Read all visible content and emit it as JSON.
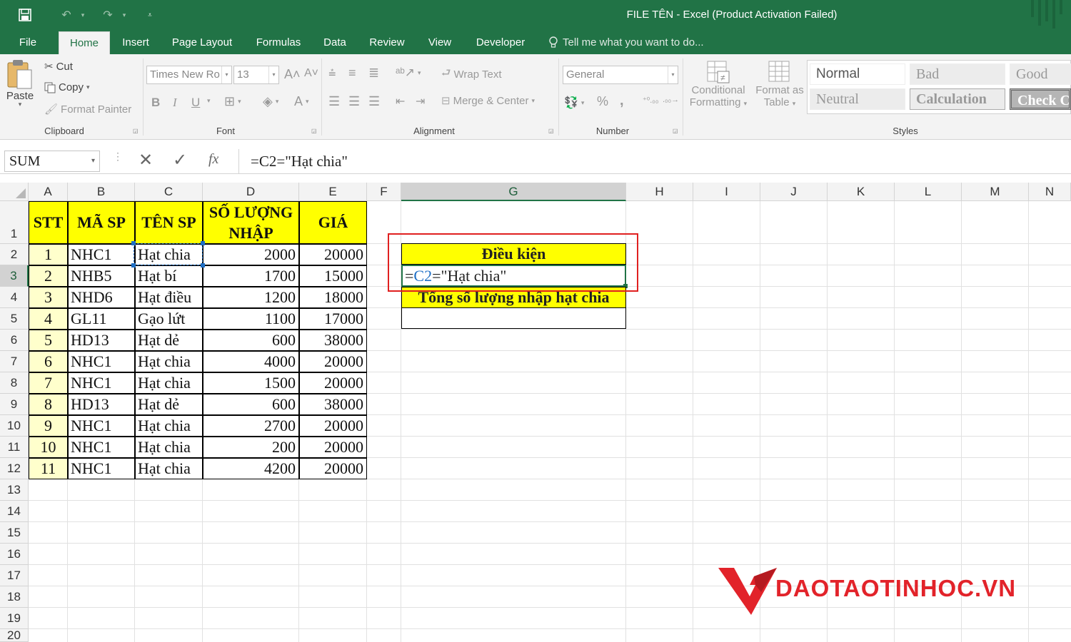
{
  "window": {
    "title": "FILE TÊN - Excel (Product Activation Failed)"
  },
  "tabs": [
    "File",
    "Home",
    "Insert",
    "Page Layout",
    "Formulas",
    "Data",
    "Review",
    "View",
    "Developer"
  ],
  "tell_me": "Tell me what you want to do...",
  "clipboard": {
    "paste": "Paste",
    "cut": "Cut",
    "copy": "Copy",
    "format_painter": "Format Painter",
    "label": "Clipboard"
  },
  "font": {
    "name": "Times New Ro",
    "size": "13",
    "bold": "B",
    "italic": "I",
    "underline": "U",
    "label": "Font"
  },
  "alignment": {
    "wrap_text": "Wrap Text",
    "merge_center": "Merge & Center",
    "label": "Alignment"
  },
  "number": {
    "format": "General",
    "percent": "%",
    "comma": ",",
    "label": "Number"
  },
  "styles": {
    "conditional_1": "Conditional",
    "conditional_2": "Formatting",
    "format_table_1": "Format as",
    "format_table_2": "Table",
    "normal": "Normal",
    "bad": "Bad",
    "good": "Good",
    "neutral": "Neutral",
    "calculation": "Calculation",
    "check": "Check C",
    "label": "Styles"
  },
  "formula_bar": {
    "name_box": "SUM",
    "formula": "=C2=\"Hạt chia\"",
    "fx": "fx"
  },
  "columns": [
    "A",
    "B",
    "C",
    "D",
    "E",
    "F",
    "G",
    "H",
    "I",
    "J",
    "K",
    "L",
    "M",
    "N"
  ],
  "rows": [
    "1",
    "2",
    "3",
    "4",
    "5",
    "6",
    "7",
    "8",
    "9",
    "10",
    "11",
    "12",
    "13",
    "14",
    "15",
    "16",
    "17",
    "18",
    "19",
    "20"
  ],
  "table": {
    "headers": [
      "STT",
      "MÃ SP",
      "TÊN SP",
      "SỐ LƯỢNG NHẬP",
      "GIÁ"
    ],
    "header_line1": "SỐ LƯỢNG",
    "header_line2": "NHẬP",
    "rows": [
      [
        "1",
        "NHC1",
        "Hạt chia",
        "2000",
        "20000"
      ],
      [
        "2",
        "NHB5",
        "Hạt bí",
        "1700",
        "15000"
      ],
      [
        "3",
        "NHD6",
        "Hạt điều",
        "1200",
        "18000"
      ],
      [
        "4",
        "GL11",
        "Gạo lứt",
        "1100",
        "17000"
      ],
      [
        "5",
        "HD13",
        "Hạt dẻ",
        "600",
        "38000"
      ],
      [
        "6",
        "NHC1",
        "Hạt chia",
        "4000",
        "20000"
      ],
      [
        "7",
        "NHC1",
        "Hạt chia",
        "1500",
        "20000"
      ],
      [
        "8",
        "HD13",
        "Hạt dẻ",
        "600",
        "38000"
      ],
      [
        "9",
        "NHC1",
        "Hạt chia",
        "2700",
        "20000"
      ],
      [
        "10",
        "NHC1",
        "Hạt chia",
        "200",
        "20000"
      ],
      [
        "11",
        "NHC1",
        "Hạt chia",
        "4200",
        "20000"
      ]
    ]
  },
  "criteria": {
    "title": "Điều kiện",
    "formula_ref": "C2",
    "formula_eq": "=",
    "formula_rest": "=\"Hạt chia\"",
    "total_label": "Tổng số lượng nhập hạt chia"
  },
  "watermark": "DAOTAOTINHOC.VN",
  "colors": {
    "excel_green": "#217346",
    "header_yellow": "#ffff00",
    "stt_fill": "#ffffcc",
    "highlight_red": "#e02020",
    "ref_blue": "#1f6fc5"
  }
}
